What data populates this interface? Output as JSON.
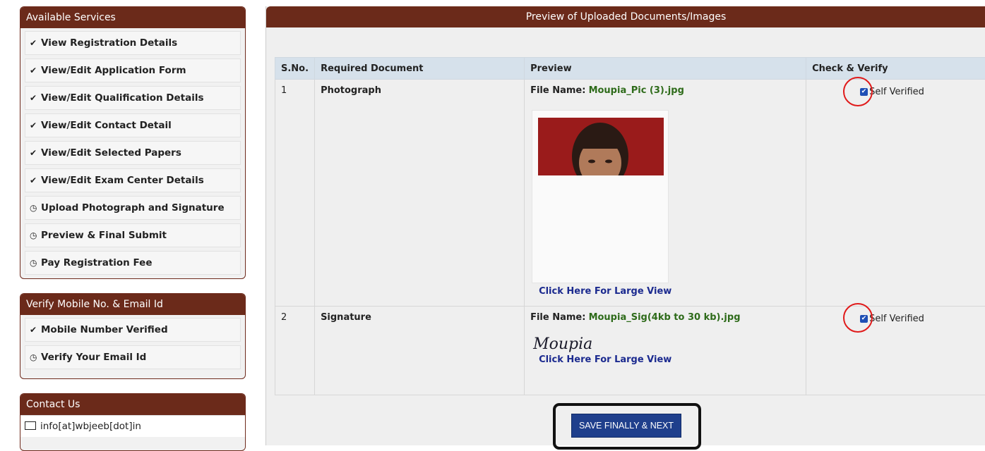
{
  "sidebar": {
    "services": {
      "title": "Available Services",
      "items": [
        {
          "icon": "check-circle-icon",
          "label": "View Registration Details"
        },
        {
          "icon": "check-circle-icon",
          "label": "View/Edit Application Form"
        },
        {
          "icon": "check-circle-icon",
          "label": "View/Edit Qualification Details"
        },
        {
          "icon": "check-circle-icon",
          "label": "View/Edit Contact Detail"
        },
        {
          "icon": "check-circle-icon",
          "label": "View/Edit Selected Papers"
        },
        {
          "icon": "check-circle-icon",
          "label": "View/Edit Exam Center Details"
        },
        {
          "icon": "clock-icon",
          "label": "Upload Photograph and Signature"
        },
        {
          "icon": "clock-icon",
          "label": "Preview & Final Submit"
        },
        {
          "icon": "clock-icon",
          "label": "Pay Registration Fee"
        }
      ]
    },
    "verify": {
      "title": "Verify Mobile No. & Email Id",
      "items": [
        {
          "icon": "check-circle-icon",
          "label": "Mobile Number Verified"
        },
        {
          "icon": "clock-icon",
          "label": "Verify Your Email Id"
        }
      ]
    },
    "contact": {
      "title": "Contact Us",
      "email": "info[at]wbjeeb[dot]in",
      "icon": "envelope-icon"
    }
  },
  "main": {
    "title": "Preview of Uploaded Documents/Images",
    "columns": [
      "S.No.",
      "Required Document",
      "Preview",
      "Check & Verify"
    ],
    "rows": [
      {
        "sno": "1",
        "document": "Photograph",
        "file_label": "File Name:",
        "file_name": "Moupia_Pic (3).jpg",
        "link": "Click Here For Large View",
        "verify_label": "Self Verified",
        "checked": true
      },
      {
        "sno": "2",
        "document": "Signature",
        "file_label": "File Name:",
        "file_name": "Moupia_Sig(4kb to 30 kb).jpg",
        "signature_text": "Moupia",
        "link": "Click Here For Large View",
        "verify_label": "Self Verified",
        "checked": true
      }
    ],
    "save_button": "SAVE FINALLY & NEXT"
  },
  "colors": {
    "header_brown": "#6b2a1a",
    "table_header": "#d6e1eb",
    "link_blue": "#1b2a8f",
    "file_green": "#2e6b1a",
    "button_blue": "#1f3f8c",
    "annotation_red": "#e01a1a"
  }
}
